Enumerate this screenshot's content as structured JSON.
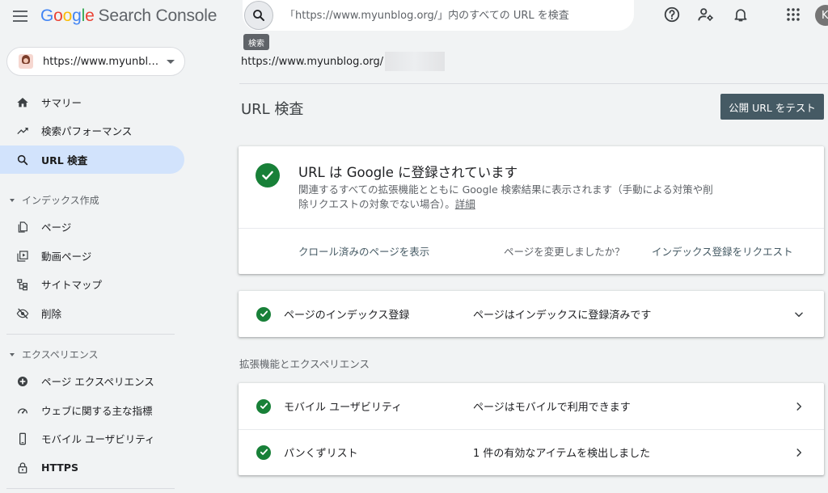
{
  "app": {
    "title_letters": [
      {
        "ch": "G",
        "color": "#4285F4"
      },
      {
        "ch": "o",
        "color": "#EA4335"
      },
      {
        "ch": "o",
        "color": "#FBBC05"
      },
      {
        "ch": "g",
        "color": "#4285F4"
      },
      {
        "ch": "l",
        "color": "#34A853"
      },
      {
        "ch": "e",
        "color": "#EA4335"
      }
    ],
    "product": "Search Console"
  },
  "property": {
    "label": "https://www.myunbl…"
  },
  "search": {
    "placeholder": "「https://www.myunblog.org/」内のすべての URL を検査",
    "tooltip": "検索"
  },
  "header": {
    "avatar_letter": "K"
  },
  "sidebar": {
    "items": [
      {
        "label": "サマリー",
        "icon": "home-icon"
      },
      {
        "label": "検索パフォーマンス",
        "icon": "trending-up-icon"
      },
      {
        "label": "URL 検査",
        "icon": "search-icon",
        "active": true
      }
    ],
    "index_section": {
      "header": "インデックス作成",
      "items": [
        {
          "label": "ページ",
          "icon": "pages-icon"
        },
        {
          "label": "動画ページ",
          "icon": "video-pages-icon"
        },
        {
          "label": "サイトマップ",
          "icon": "sitemap-icon"
        },
        {
          "label": "削除",
          "icon": "removals-icon"
        }
      ]
    },
    "experience_section": {
      "header": "エクスペリエンス",
      "items": [
        {
          "label": "ページ エクスペリエンス",
          "icon": "page-experience-icon"
        },
        {
          "label": "ウェブに関する主な指標",
          "icon": "gauge-icon"
        },
        {
          "label": "モバイル ユーザビリティ",
          "icon": "mobile-icon"
        },
        {
          "label": "HTTPS",
          "icon": "lock-icon"
        }
      ]
    }
  },
  "main": {
    "page_url": "https://www.myunblog.org/",
    "title": "URL 検査",
    "test_button": "公開 URL をテスト",
    "status": {
      "title": "URL は Google に登録されています",
      "description": "関連するすべての拡張機能とともに Google 検索結果に表示されます（手動による対策や削除リクエストの対象でない場合）。",
      "details_link": "詳細",
      "view_crawled": "クロール済みのページを表示",
      "question": "ページを変更しましたか？",
      "request_indexing": "インデックス登録をリクエスト"
    },
    "index_row": {
      "label": "ページのインデックス登録",
      "value": "ページはインデックスに登録済みです"
    },
    "enhancements_header": "拡張機能とエクスペリエンス",
    "enhancements": [
      {
        "label": "モバイル ユーザビリティ",
        "value": "ページはモバイルで利用できます"
      },
      {
        "label": "パンくずリスト",
        "value": "1 件の有効なアイテムを検出しました"
      }
    ]
  },
  "colors": {
    "success": "#188038",
    "active_nav": "#d2e3fc",
    "button": "#455a64",
    "background": "#f1f3f4"
  }
}
